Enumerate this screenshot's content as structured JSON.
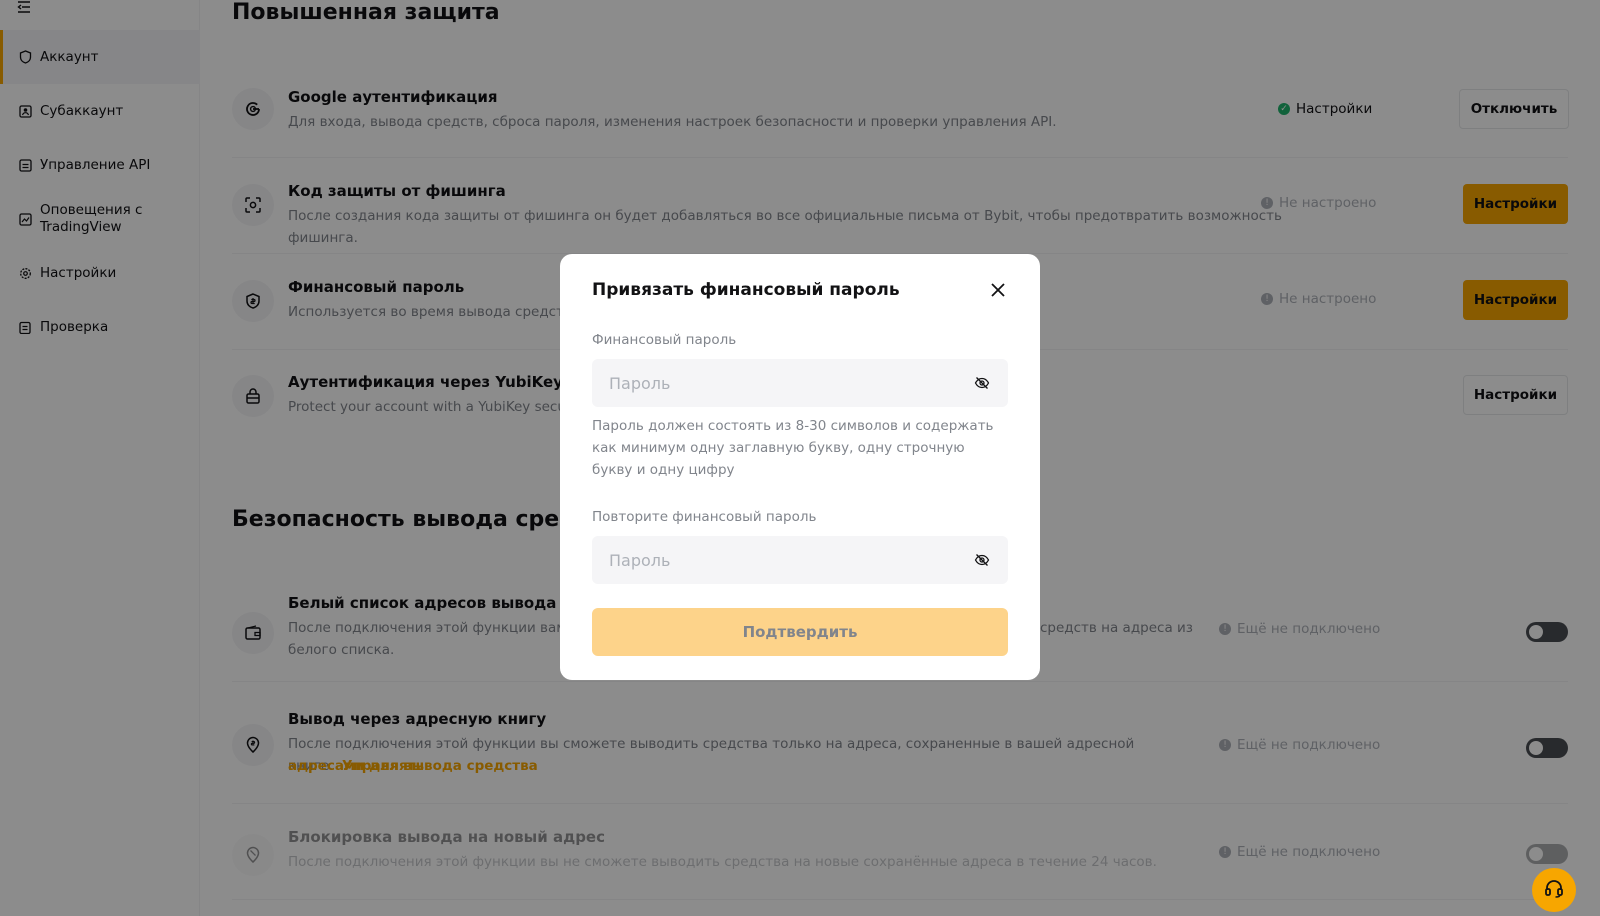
{
  "sidebar": {
    "items": [
      {
        "label": "Аккаунт",
        "icon": "shield-icon"
      },
      {
        "label": "Субаккаунт",
        "icon": "subaccount-icon"
      },
      {
        "label": "Управление API",
        "icon": "api-icon"
      },
      {
        "label": "Оповещения с TradingView",
        "icon": "tradingview-icon"
      },
      {
        "label": "Настройки",
        "icon": "gear-icon"
      },
      {
        "label": "Проверка",
        "icon": "clipboard-icon"
      }
    ]
  },
  "main": {
    "section1_title": "Повышенная защита",
    "section2_title": "Безопасность вывода средств",
    "rows": [
      {
        "title": "Google аутентификация",
        "desc": "Для входа, вывода средств, сброса пароля, изменения настроек безопасности и проверки управления API.",
        "status": "Настройки",
        "button": "Отключить"
      },
      {
        "title": "Код защиты от фишинга",
        "desc": "После создания кода защиты от фишинга он будет добавляться во все официальные письма от Bybit, чтобы предотвратить возможность фишинга.",
        "status": "Не настроено",
        "button": "Настройки"
      },
      {
        "title": "Финансовый пароль",
        "desc": "Используется во время вывода средств, п",
        "status": "Не настроено",
        "button": "Настройки"
      },
      {
        "title": "Аутентификация через YubiKey",
        "desc": "Protect your account with a YubiKey securit",
        "button": "Настройки"
      }
    ],
    "withdraw_rows": [
      {
        "title": "Белый список адресов вывода",
        "desc_left": "После подключения этой функции вам не",
        "desc_right": "средств на адреса из",
        "desc_line2": "белого списка.",
        "status": "Ещё не подключено"
      },
      {
        "title": "Вывод через адресную книгу",
        "desc": "После подключения этой функции вы сможете выводить средства только на адреса, сохраненные в вашей адресной книге.",
        "link_part1": "Управлять",
        "link_part2": "адресами для вывода средства",
        "status": "Ещё не подключено"
      },
      {
        "title": "Блокировка вывода на новый адрес",
        "desc": "После подключения этой функции вы не сможете выводить средства на новые сохранённые адреса в течение 24 часов.",
        "status": "Ещё не подключено"
      }
    ]
  },
  "modal": {
    "title": "Привязать финансовый пароль",
    "field1_label": "Финансовый пароль",
    "field1_placeholder": "Пароль",
    "hint": "Пароль должен состоять из 8-30 символов и содержать как минимум одну заглавную букву, одну строчную букву и одну цифру",
    "field2_label": "Повторите финансовый пароль",
    "field2_placeholder": "Пароль",
    "confirm": "Подтвердить"
  },
  "colors": {
    "accent": "#f7a600",
    "confirm_disabled": "#fdd38a",
    "success": "#20b26c",
    "muted": "#81858c"
  }
}
